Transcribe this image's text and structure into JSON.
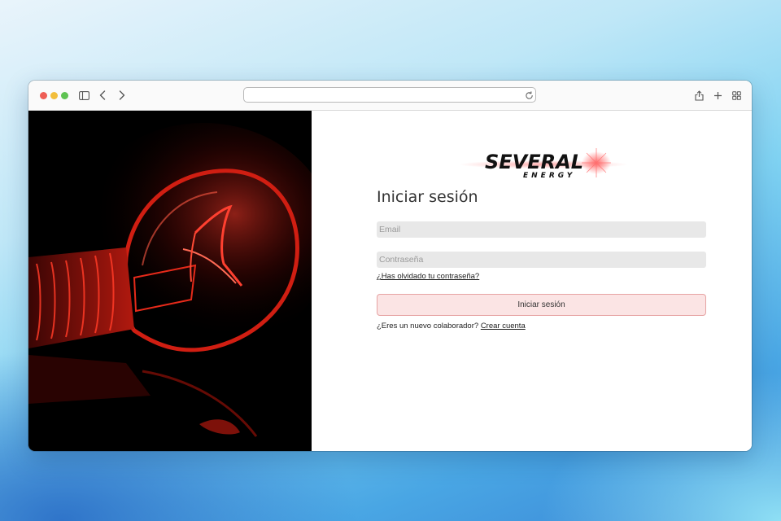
{
  "browser": {
    "address_value": "",
    "icons": [
      "sidebar-icon",
      "back-icon",
      "forward-icon",
      "reload-icon",
      "share-icon",
      "new-tab-icon",
      "tab-overview-icon"
    ]
  },
  "brand": {
    "name": "SEVERAL",
    "tagline": "ENERGY"
  },
  "login": {
    "title": "Iniciar sesión",
    "email_placeholder": "Email",
    "email_value": "",
    "password_placeholder": "Contraseña",
    "password_value": "",
    "forgot_link": "¿Has olvidado tu contraseña?",
    "submit_label": "Iniciar sesión",
    "register_prompt": "¿Eres un nuevo colaborador?",
    "register_link": "Crear cuenta"
  },
  "colors": {
    "accent": "#e63a3a",
    "button_bg": "#fbe4e4",
    "button_border": "#e6a3a3",
    "field_bg": "#e8e8e8",
    "hero_bg": "#000000"
  }
}
